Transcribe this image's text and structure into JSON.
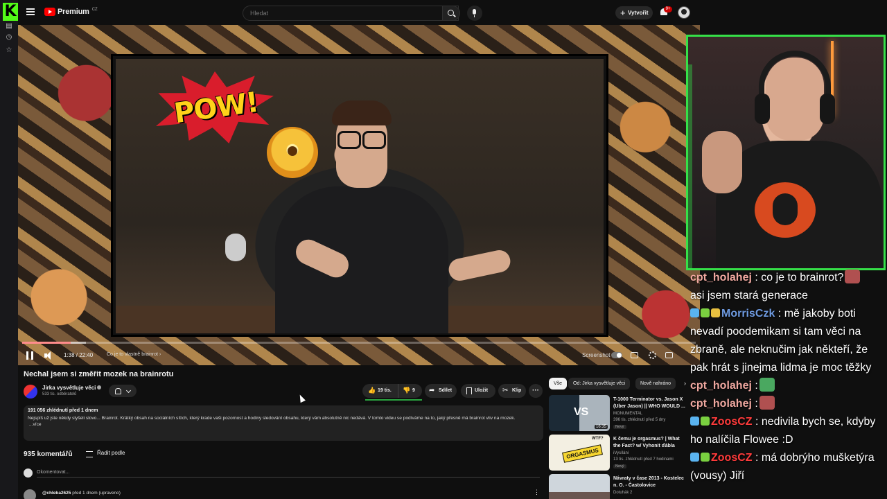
{
  "youtube": {
    "brand": "Premium",
    "region": "CZ",
    "search_placeholder": "Hledat",
    "create_label": "Vytvořit",
    "notif_count": "9+"
  },
  "player": {
    "time": "1:38 / 22:40",
    "chapter": "Co je to vlastně brainrot",
    "screenshot_label": "Screenshot",
    "progress": 0.072,
    "buffer": 0.095,
    "sticker_text": "POW!"
  },
  "video": {
    "title": "Nechal jsem si změřit mozek na brainrotu",
    "channel_name": "Jirka vysvětluje věci",
    "channel_subs": "533 tis. odběratelů",
    "likes": "19 tis.",
    "dislikes": "9",
    "share_label": "Sdílet",
    "save_label": "Uložit",
    "clip_label": "Klip",
    "more_label": "···"
  },
  "description": {
    "meta": "191 056 zhlédnutí  před 1 dnem",
    "text": "Nejspíš už jste někdy slyšeli slovo... Brainrot. Krátký obsah na sociálních sítích, který krade vaši pozornost a hodiny sledování obsahu, který vám absolutně nic nedává. V tomto videu se podíváme na to, jaký přesně má brainrot vliv na mozek.",
    "more": "...více"
  },
  "comments": {
    "count": "935 komentářů",
    "sort_label": "Řadit podle",
    "input_placeholder": "Okomentovat...",
    "first_author": "@chleba2625",
    "first_time": "před 1 dnem (upraveno)"
  },
  "related": {
    "chips": [
      "Vše",
      "Od: Jirka vysvětluje věci",
      "Nově nahráno"
    ],
    "items": [
      {
        "title": "T-1000 Terminator vs. Jason X (Uber Jason) || WHO WOULD ...",
        "channel": "MONUMENTAL",
        "stats": "396 tis. zhlédnutí  před 5 dny",
        "badge": "Nový",
        "duration": "16:35",
        "thumb_text": "VS"
      },
      {
        "title": "K čemu je orgasmus? | What the Fact? w/ Vyhonit ďábla",
        "channel": "iVysílání",
        "stats": "13 tis. zhlédnutí  před 7 hodinami",
        "badge": "Nový",
        "duration": "",
        "thumb_text": "ORGASMUS",
        "thumb_text2": "WTF?"
      },
      {
        "title": "Návraty v čase  2013 - Kostelec n. O. - Častolovice",
        "channel": "Dotuhák 2",
        "stats": "",
        "badge": "",
        "duration": ""
      }
    ]
  },
  "chat": [
    {
      "user": "cpt_holahej",
      "user_color": "#f0a8a0",
      "text": ": co je to brainrot?",
      "cont": "asi jsem stará generace",
      "emote": true,
      "badges": []
    },
    {
      "user": "MorrisCzk",
      "user_color": "#6e9ae0",
      "text": ": mě jakoby boti nevadí poodemikam si tam věci na zbraně, ale neknučim jak někteří, že pak hrát s jinejma lidma je moc těžky",
      "badges": [
        "#5ab4f0",
        "#7ad040",
        "#e8c040"
      ]
    },
    {
      "user": "cpt_holahej",
      "user_color": "#f0a8a0",
      "text": ":",
      "emote": true,
      "badges": []
    },
    {
      "user": "cpt_holahej",
      "user_color": "#f0a8a0",
      "text": ":",
      "emote": true,
      "badges": []
    },
    {
      "user": "ZoosCZ",
      "user_color": "#ff3b3b",
      "text": ": nedivila bych se, kdyby ho nalíčila Flowee :D",
      "badges": [
        "#5ab4f0",
        "#7ad040"
      ]
    },
    {
      "user": "ZoosCZ",
      "user_color": "#ff3b3b",
      "text": ": má dobrýho mušketýra (vousy) Jiří",
      "badges": [
        "#5ab4f0",
        "#7ad040"
      ]
    }
  ]
}
